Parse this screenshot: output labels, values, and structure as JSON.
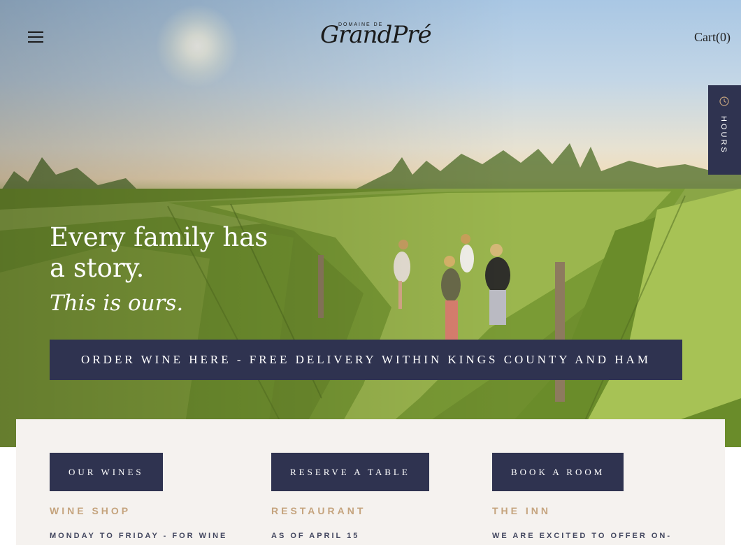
{
  "header": {
    "logo_top": "DOMAINE DE",
    "logo_main": "GrandPré",
    "cart_label": "Cart(0)",
    "hours_label": "HOURS",
    "menu_icon": "hamburger-menu-icon",
    "hours_icon": "clock-icon"
  },
  "hero": {
    "title": "Every family has a story.",
    "subtitle": "This is ours.",
    "cta_label": "ORDER WINE HERE - FREE DELIVERY WITHIN KINGS COUNTY AND HAM"
  },
  "info": {
    "columns": [
      {
        "button_label": "OUR WINES",
        "heading": "WINE SHOP",
        "text": "MONDAY TO FRIDAY - FOR WINE"
      },
      {
        "button_label": "RESERVE A TABLE",
        "heading": "RESTAURANT",
        "text": "AS OF APRIL 15"
      },
      {
        "button_label": "BOOK A ROOM",
        "heading": "THE INN",
        "text": "WE ARE EXCITED TO OFFER ON-"
      }
    ]
  },
  "colors": {
    "navy": "#2f3350",
    "gold": "#c5a47e",
    "panel_bg": "#f5f2ef",
    "body_text": "#43475f"
  }
}
